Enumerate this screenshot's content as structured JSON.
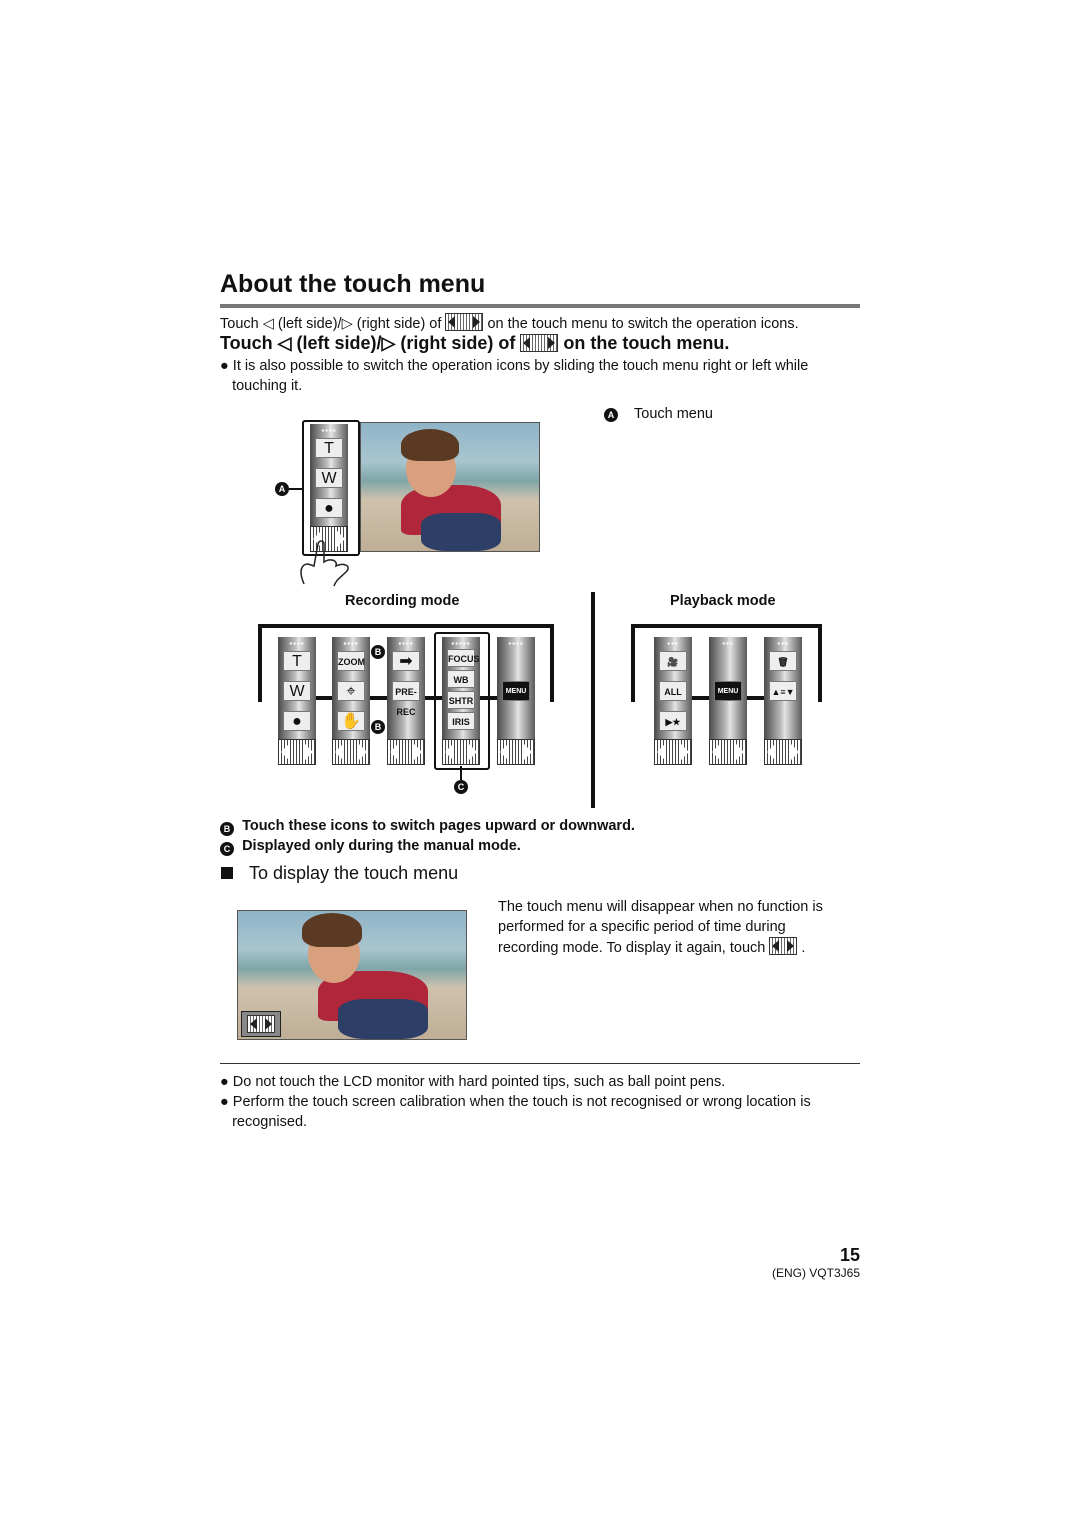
{
  "title": "About the touch menu",
  "intro": {
    "pre": "Touch",
    "left": "(left side)/",
    "right": "(right side) of",
    "post": "on the touch menu to switch the operation icons."
  },
  "step": {
    "pre": "Touch",
    "left": "(left side)/",
    "right": "(right side) of",
    "post": "on the touch menu."
  },
  "note_bullet": [
    "It is also possible to switch the operation icons by sliding the touch menu right or left while",
    "touching it."
  ],
  "legend_a": {
    "marker": "A",
    "label": "Touch menu"
  },
  "top_menu": {
    "dots": "▪▪▪▪",
    "icons": [
      "T",
      "W",
      "●"
    ]
  },
  "recording": {
    "label": "Recording mode",
    "strips": [
      {
        "dots": "▪▪▪▪",
        "icons": [
          "T",
          "W",
          "●"
        ]
      },
      {
        "dots": "▪▪▪▪",
        "icons": [
          "ZOOM",
          "⌖",
          "✋"
        ]
      },
      {
        "dots": "▪▪▪▪",
        "icons": [
          "➡",
          "PRE-REC",
          ""
        ]
      },
      {
        "dots": "▪▪▪▪▪",
        "icons": [
          "FOCUS",
          "WB",
          "SHTR",
          "IRIS"
        ]
      },
      {
        "dots": "▪▪▪▪",
        "icons": [
          "",
          "MENU",
          ""
        ]
      }
    ],
    "marker_b": "B",
    "marker_c": "C"
  },
  "playback": {
    "label": "Playback mode",
    "strips": [
      {
        "dots": "▪▪▪",
        "icons": [
          "🎥",
          "ALL",
          "▶★"
        ]
      },
      {
        "dots": "▪▪▪",
        "icons": [
          "",
          "MENU",
          ""
        ]
      },
      {
        "dots": "▪▪▪",
        "icons": [
          "🗑",
          "▲≡▼",
          ""
        ]
      }
    ]
  },
  "notes": [
    {
      "marker": "B",
      "text": "Touch these icons to switch pages upward or downward."
    },
    {
      "marker": "C",
      "text": "Displayed only during the manual mode."
    }
  ],
  "section": {
    "title": "To display the touch menu",
    "text": [
      "The touch menu will disappear when no function is",
      "performed for a specific period of time during",
      "recording mode. To display it again, touch"
    ],
    "end": "."
  },
  "cautions": [
    [
      "Do not touch the LCD monitor with hard pointed tips, such as ball point pens."
    ],
    [
      "Perform the touch screen calibration when the touch is not recognised or wrong location is",
      "recognised."
    ]
  ],
  "footer": {
    "page": "15",
    "code": "(ENG) VQT3J65"
  }
}
